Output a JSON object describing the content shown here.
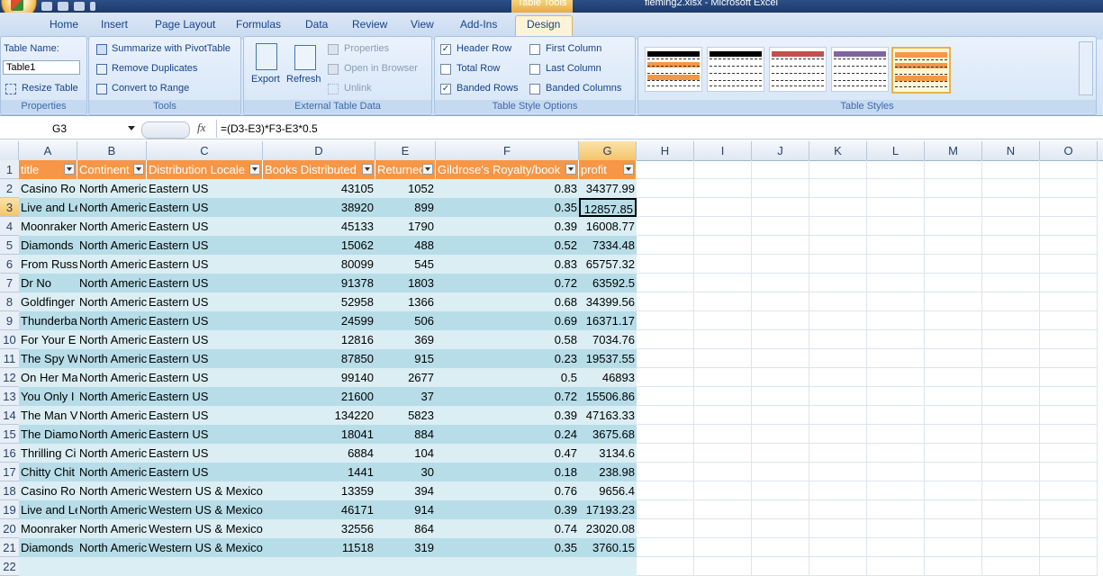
{
  "window": {
    "title": "fleming2.xlsx - Microsoft Excel",
    "context_tab": "Table Tools"
  },
  "tabs": [
    "Home",
    "Insert",
    "Page Layout",
    "Formulas",
    "Data",
    "Review",
    "View",
    "Add-Ins",
    "Design"
  ],
  "active_tab": "Design",
  "ribbon": {
    "properties": {
      "table_name_label": "Table Name:",
      "table_name_value": "Table1",
      "resize": "Resize Table",
      "group": "Properties"
    },
    "tools": {
      "pivot": "Summarize with PivotTable",
      "duplicates": "Remove Duplicates",
      "convert": "Convert to Range",
      "group": "Tools"
    },
    "external": {
      "export": "Export",
      "refresh": "Refresh",
      "properties": "Properties",
      "open_browser": "Open in Browser",
      "unlink": "Unlink",
      "group": "External Table Data"
    },
    "style_options": {
      "header_row": "Header Row",
      "total_row": "Total Row",
      "banded_rows": "Banded Rows",
      "first_column": "First Column",
      "last_column": "Last Column",
      "banded_columns": "Banded Columns",
      "group": "Table Style Options",
      "checked": {
        "header_row": true,
        "total_row": false,
        "banded_rows": true,
        "first_column": false,
        "last_column": false,
        "banded_columns": false
      }
    },
    "styles": {
      "group": "Table Styles",
      "swatch_colors": [
        "#000000",
        "#000000",
        "#c0504d",
        "#8064a2",
        "#f79646"
      ],
      "selected_index": 4
    }
  },
  "formula_bar": {
    "name_box": "G3",
    "fx": "fx",
    "formula": "=(D3-E3)*F3-E3*0.5"
  },
  "columns": [
    "A",
    "B",
    "C",
    "D",
    "E",
    "F",
    "G",
    "H",
    "I",
    "J",
    "K",
    "L",
    "M",
    "N",
    "O"
  ],
  "selected_column": "G",
  "selected_row": 3,
  "headers": [
    "title",
    "Continent",
    "Distribution Locale",
    "Books Distributed",
    "Returned",
    "Gildrose's Royalty/book",
    "profit"
  ],
  "rows": [
    [
      "Casino Ro",
      "North Americ",
      "Eastern US",
      "43105",
      "1052",
      "0.83",
      "34377.99"
    ],
    [
      "Live and Le",
      "North Americ",
      "Eastern US",
      "38920",
      "899",
      "0.35",
      "12857.85"
    ],
    [
      "Moonraker",
      "North Americ",
      "Eastern US",
      "45133",
      "1790",
      "0.39",
      "16008.77"
    ],
    [
      "Diamonds",
      "North Americ",
      "Eastern US",
      "15062",
      "488",
      "0.52",
      "7334.48"
    ],
    [
      "From Russ",
      "North Americ",
      "Eastern US",
      "80099",
      "545",
      "0.83",
      "65757.32"
    ],
    [
      "Dr No",
      "North Americ",
      "Eastern US",
      "91378",
      "1803",
      "0.72",
      "63592.5"
    ],
    [
      "Goldfinger",
      "North Americ",
      "Eastern US",
      "52958",
      "1366",
      "0.68",
      "34399.56"
    ],
    [
      "Thunderba",
      "North Americ",
      "Eastern US",
      "24599",
      "506",
      "0.69",
      "16371.17"
    ],
    [
      "For Your E",
      "North Americ",
      "Eastern US",
      "12816",
      "369",
      "0.58",
      "7034.76"
    ],
    [
      "The Spy W",
      "North Americ",
      "Eastern US",
      "87850",
      "915",
      "0.23",
      "19537.55"
    ],
    [
      "On Her Ma",
      "North Americ",
      "Eastern US",
      "99140",
      "2677",
      "0.5",
      "46893"
    ],
    [
      "You Only I",
      "North Americ",
      "Eastern US",
      "21600",
      "37",
      "0.72",
      "15506.86"
    ],
    [
      "The Man V",
      "North Americ",
      "Eastern US",
      "134220",
      "5823",
      "0.39",
      "47163.33"
    ],
    [
      "The Diamo",
      "North Americ",
      "Eastern US",
      "18041",
      "884",
      "0.24",
      "3675.68"
    ],
    [
      "Thrilling Ci",
      "North Americ",
      "Eastern US",
      "6884",
      "104",
      "0.47",
      "3134.6"
    ],
    [
      "Chitty Chit",
      "North Americ",
      "Eastern US",
      "1441",
      "30",
      "0.18",
      "238.98"
    ],
    [
      "Casino Ro",
      "North Americ",
      "Western US & Mexico",
      "13359",
      "394",
      "0.76",
      "9656.4"
    ],
    [
      "Live and Le",
      "North Americ",
      "Western US & Mexico",
      "46171",
      "914",
      "0.39",
      "17193.23"
    ],
    [
      "Moonraker",
      "North Americ",
      "Western US & Mexico",
      "32556",
      "864",
      "0.74",
      "23020.08"
    ],
    [
      "Diamonds",
      "North Americ",
      "Western US & Mexico",
      "11518",
      "319",
      "0.35",
      "3760.15"
    ]
  ]
}
